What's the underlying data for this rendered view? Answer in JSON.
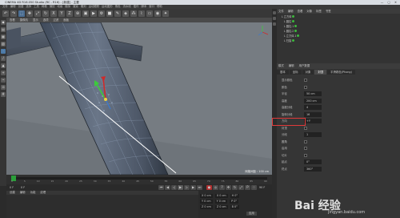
{
  "window": {
    "title": "CINEMA 4D R16.050 Studio (RC - R16) - [新建] - 主要",
    "controls": "— ▢ ✕"
  },
  "menu_items": [
    "文件",
    "编辑",
    "创建",
    "选择",
    "工具",
    "网格",
    "捕捉",
    "动画",
    "模拟",
    "渲染",
    "雕刻",
    "运动跟踪",
    "运动图形",
    "角色",
    "流水线",
    "插件",
    "脚本",
    "窗口",
    "帮助"
  ],
  "viewport": {
    "menu": [
      "查看",
      "摄像机",
      "显示",
      "选项",
      "过滤",
      "面板"
    ],
    "grid_distance": "网格间距 : 100 cm"
  },
  "timeline": {
    "ticks": [
      "0",
      "5",
      "10",
      "15",
      "20",
      "25",
      "30",
      "35",
      "40",
      "45",
      "50",
      "55",
      "60",
      "65",
      "70",
      "75",
      "80",
      "85",
      "90"
    ],
    "frame": "0 F",
    "end_frame": "90 F"
  },
  "material": {
    "menu": [
      "创建",
      "编辑",
      "功能",
      "纹理"
    ]
  },
  "coordinates": {
    "rows": [
      {
        "a": "X 0 cm",
        "b": "X 0 cm",
        "c": "H 0°"
      },
      {
        "a": "Y 0 cm",
        "b": "Y 0 cm",
        "c": "P 0°"
      },
      {
        "a": "Z 0 cm",
        "b": "Z 0 cm",
        "c": "B 0°"
      }
    ],
    "apply": "应用"
  },
  "object_manager": {
    "menu": [
      "文件",
      "编辑",
      "查看",
      "对象",
      "标签",
      "书签"
    ],
    "rows": [
      "L 立方体",
      "L 圆柱",
      "L 圆柱.1",
      "L 圆柱.2",
      "L 立方体.1",
      "L 扫描"
    ]
  },
  "attribute_manager": {
    "menu": [
      "模式",
      "编辑",
      "用户数据"
    ],
    "tabs": [
      "基本",
      "坐标",
      "对象",
      "封顶",
      "平滑着色(Phong)"
    ],
    "rows": [
      {
        "label": "显示颜色",
        "value": ""
      },
      {
        "label": "颜色",
        "value": ""
      },
      {
        "label": "半径",
        "value": "50 cm"
      },
      {
        "label": "高度",
        "value": "200 cm"
      },
      {
        "label": "高度分段",
        "value": "4"
      },
      {
        "label": "旋转分段",
        "value": "16"
      },
      {
        "label": "方向",
        "value": "+Y"
      },
      {
        "label": "封顶",
        "value": ""
      },
      {
        "label": "分段",
        "value": "1"
      },
      {
        "label": "圆角",
        "value": ""
      },
      {
        "label": "启用",
        "value": ""
      },
      {
        "label": "切片",
        "value": ""
      },
      {
        "label": "起点",
        "value": "0°"
      },
      {
        "label": "终点",
        "value": "360°"
      }
    ],
    "highlight_label": "封顶"
  },
  "watermark": {
    "text": "Bai 经验",
    "sub": "jingyan.baidu.com"
  },
  "colors": {
    "accent": "#e03a3a",
    "active_tool": "#4a6d92",
    "viewport_bg": "#757b81"
  }
}
